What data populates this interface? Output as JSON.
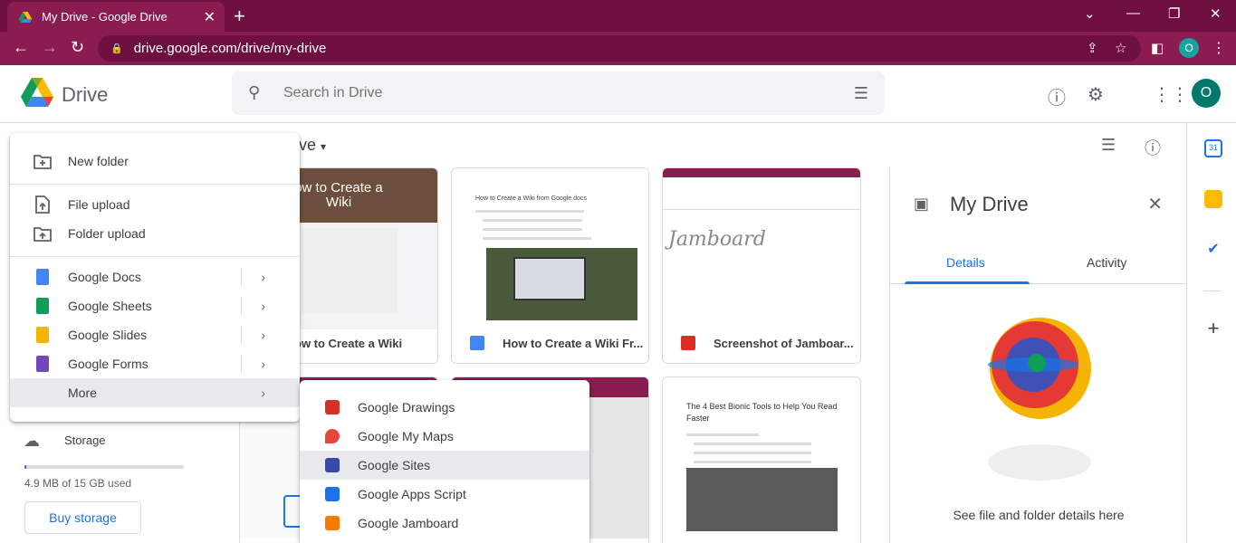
{
  "browser": {
    "tab_title": "My Drive - Google Drive",
    "url": "drive.google.com/drive/my-drive",
    "profile_initial": "O",
    "chrome_color": "#8a1c50"
  },
  "drive": {
    "brand": "Drive",
    "search_placeholder": "Search in Drive",
    "avatar_initial": "O",
    "breadcrumb_tail": "ve"
  },
  "new_menu": {
    "items": [
      {
        "label": "New folder"
      },
      {
        "label": "File upload"
      },
      {
        "label": "Folder upload"
      },
      {
        "label": "Google Docs"
      },
      {
        "label": "Google Sheets"
      },
      {
        "label": "Google Slides"
      },
      {
        "label": "Google Forms"
      },
      {
        "label": "More"
      }
    ]
  },
  "more_menu": {
    "items": [
      {
        "label": "Google Drawings",
        "color": "#d93025"
      },
      {
        "label": "Google My Maps",
        "color": "#e8453c"
      },
      {
        "label": "Google Sites",
        "color": "#3949ab"
      },
      {
        "label": "Google Apps Script",
        "color": "#1a73e8"
      },
      {
        "label": "Google Jamboard",
        "color": "#f57c00"
      }
    ]
  },
  "files": [
    {
      "title": "ow to Create a Wiki",
      "thumb_heading": "ow to Create a\nWiki"
    },
    {
      "title": "How to Create a Wiki Fr...",
      "thumb_heading": "How to Create a Wiki from Google docs"
    },
    {
      "title": "Screenshot of Jamboar...",
      "thumb_heading": "Jamboard"
    },
    {
      "title": "",
      "thumb_heading": "The 4 Best Bionic Tools to Help You Read Faster"
    }
  ],
  "details": {
    "title": "My Drive",
    "tab_details": "Details",
    "tab_activity": "Activity",
    "hint": "See file and folder details here"
  },
  "storage": {
    "label": "Storage",
    "used": "4.9 MB of 15 GB used",
    "used_fraction": 0.0003,
    "buy_label": "Buy storage"
  }
}
